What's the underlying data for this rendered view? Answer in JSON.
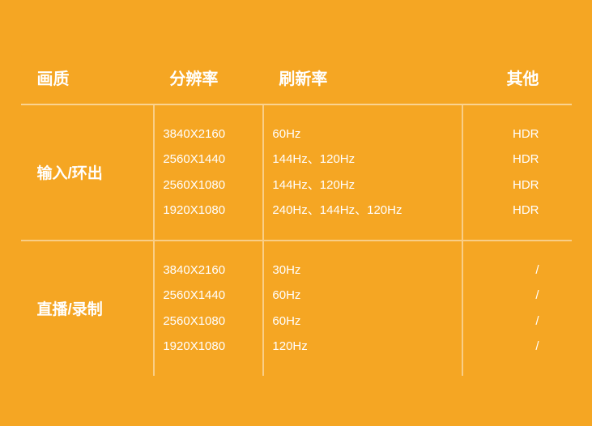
{
  "colors": {
    "background": "#f5a623",
    "section_bg": "#f0a020",
    "text_white": "#ffffff",
    "divider": "rgba(255,255,255,0.45)"
  },
  "header": {
    "col1": "画质",
    "col2": "分辨率",
    "col3": "刷新率",
    "col4": "其他"
  },
  "sections": [
    {
      "label": "输入/环出",
      "rows": [
        {
          "resolution": "3840X2160",
          "refresh": "60Hz",
          "other": "HDR"
        },
        {
          "resolution": "2560X1440",
          "refresh": "144Hz、120Hz",
          "other": "HDR"
        },
        {
          "resolution": "2560X1080",
          "refresh": "144Hz、120Hz",
          "other": "HDR"
        },
        {
          "resolution": "1920X1080",
          "refresh": "240Hz、144Hz、120Hz",
          "other": "HDR"
        }
      ]
    },
    {
      "label": "直播/录制",
      "rows": [
        {
          "resolution": "3840X2160",
          "refresh": "30Hz",
          "other": "/"
        },
        {
          "resolution": "2560X1440",
          "refresh": "60Hz",
          "other": "/"
        },
        {
          "resolution": "2560X1080",
          "refresh": "60Hz",
          "other": "/"
        },
        {
          "resolution": "1920X1080",
          "refresh": "120Hz",
          "other": "/"
        }
      ]
    }
  ]
}
